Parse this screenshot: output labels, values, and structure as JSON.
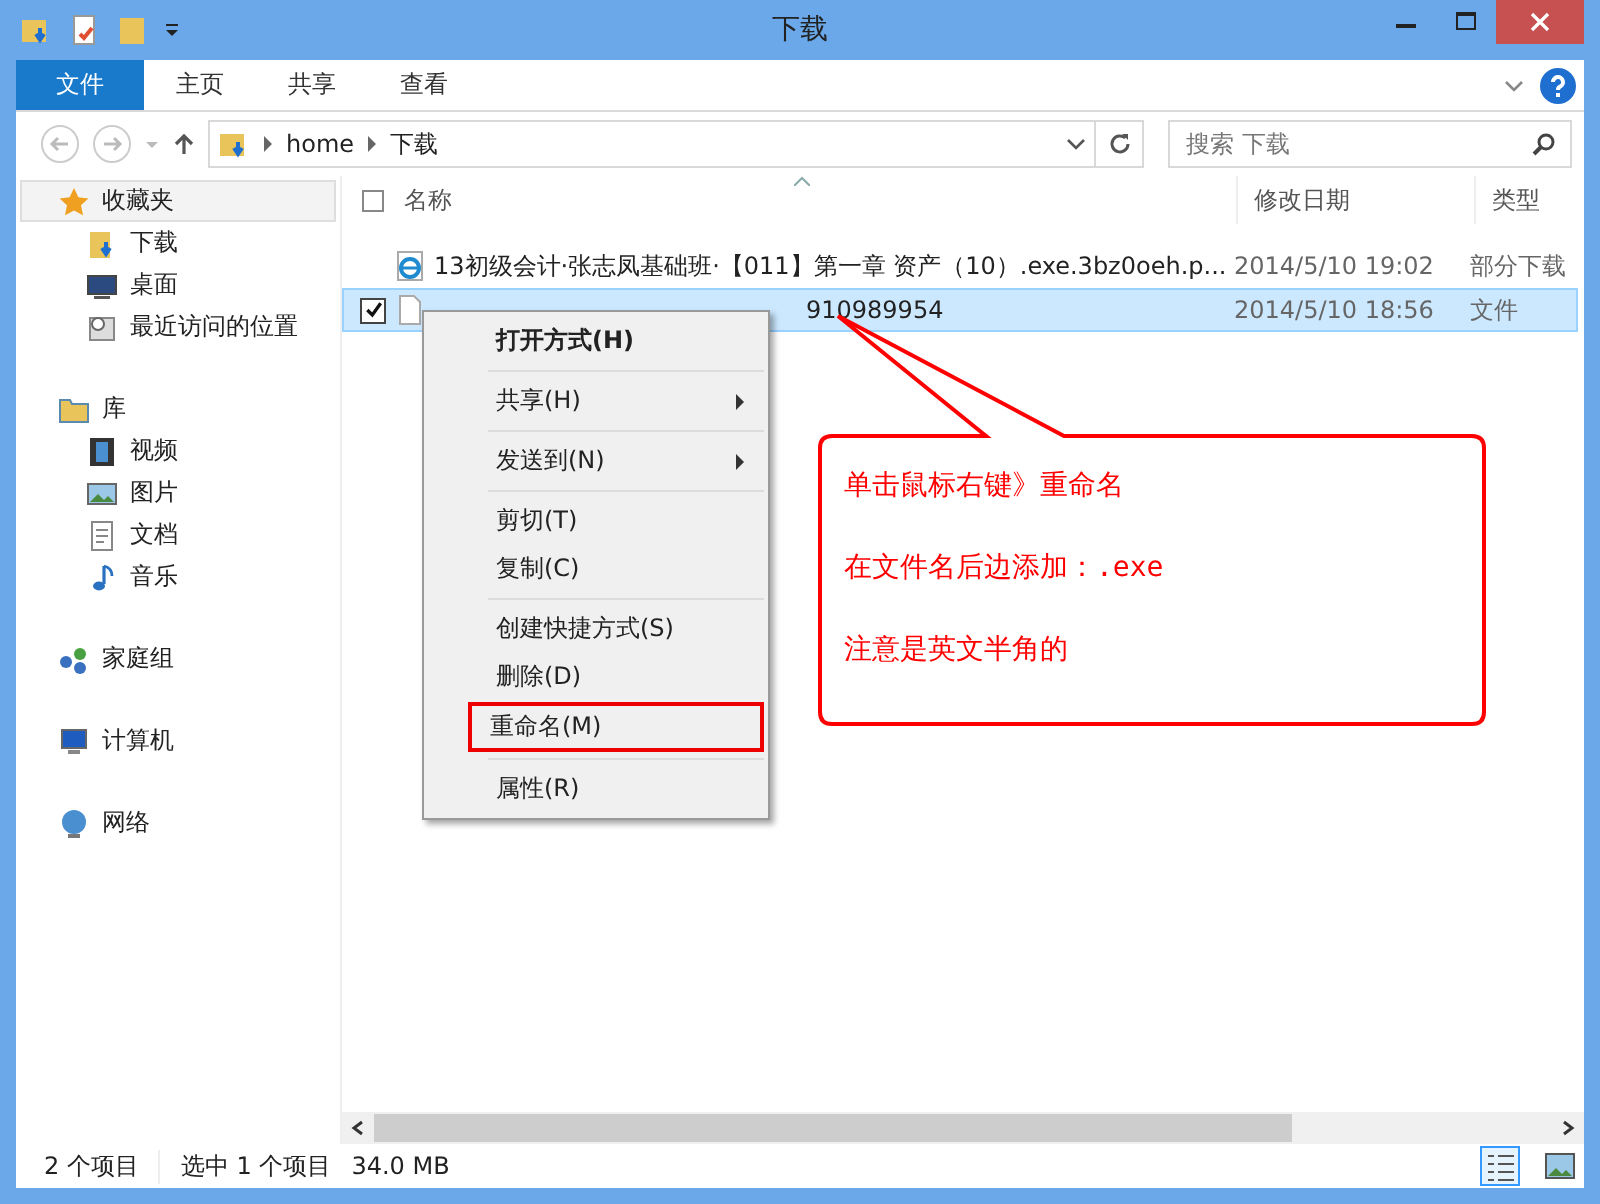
{
  "window": {
    "title": "下载"
  },
  "ribbon": {
    "tabs": [
      {
        "label": "文件",
        "selected": true
      },
      {
        "label": "主页",
        "selected": false
      },
      {
        "label": "共享",
        "selected": false
      },
      {
        "label": "查看",
        "selected": false
      }
    ]
  },
  "address": {
    "path": [
      "home",
      "下载"
    ],
    "search": {
      "placeholder": "搜索 下载"
    }
  },
  "sidebar": {
    "items": [
      {
        "label": "收藏夹",
        "selected": true,
        "children": [
          {
            "label": "下载",
            "selected": false
          },
          {
            "label": "桌面",
            "selected": false
          },
          {
            "label": "最近访问的位置",
            "selected": false
          }
        ]
      },
      {
        "label": "库",
        "selected": false,
        "children": [
          {
            "label": "视频",
            "selected": false
          },
          {
            "label": "图片",
            "selected": false
          },
          {
            "label": "文档",
            "selected": false
          },
          {
            "label": "音乐",
            "selected": false
          }
        ]
      },
      {
        "label": "家庭组",
        "selected": false
      },
      {
        "label": "计算机",
        "selected": false
      },
      {
        "label": "网络",
        "selected": false
      }
    ]
  },
  "table": {
    "columns": [
      "名称",
      "修改日期",
      "类型"
    ],
    "select_all": {
      "checked": false
    },
    "rows": [
      {
        "name": "13初级会计·张志凤基础班·【011】第一章  资产（10）.exe.3bz0oeh.p...",
        "date": "2014/5/10 19:02",
        "type": "部分下载",
        "kind": "web",
        "selected": false,
        "checked": false
      },
      {
        "name": "910989954",
        "date": "2014/5/10 18:56",
        "type": "文件",
        "kind": "file",
        "selected": true,
        "checked": true
      }
    ]
  },
  "context_menu": {
    "items": [
      {
        "label": "打开方式(H)",
        "kind": "bold",
        "marked": false
      },
      {
        "label": "共享(H)",
        "kind": "submenu",
        "marked": false
      },
      {
        "label": "发送到(N)",
        "kind": "submenu",
        "marked": false
      },
      {
        "label": "剪切(T)",
        "kind": "plain",
        "marked": false
      },
      {
        "label": "复制(C)",
        "kind": "plain",
        "marked": false
      },
      {
        "label": "创建快捷方式(S)",
        "kind": "plain",
        "marked": false
      },
      {
        "label": "删除(D)",
        "kind": "plain",
        "marked": false
      },
      {
        "label": "重命名(M)",
        "kind": "plain",
        "marked": true
      },
      {
        "label": "属性(R)",
        "kind": "plain",
        "marked": false
      }
    ]
  },
  "callout": {
    "lines": [
      "单击鼠标右键》重命名",
      "在文件名后边添加：.exe",
      "注意是英文半角的"
    ]
  },
  "status_bar": {
    "count": "2 个项目",
    "selection": "选中 1 个项目",
    "size": "34.0 MB"
  }
}
